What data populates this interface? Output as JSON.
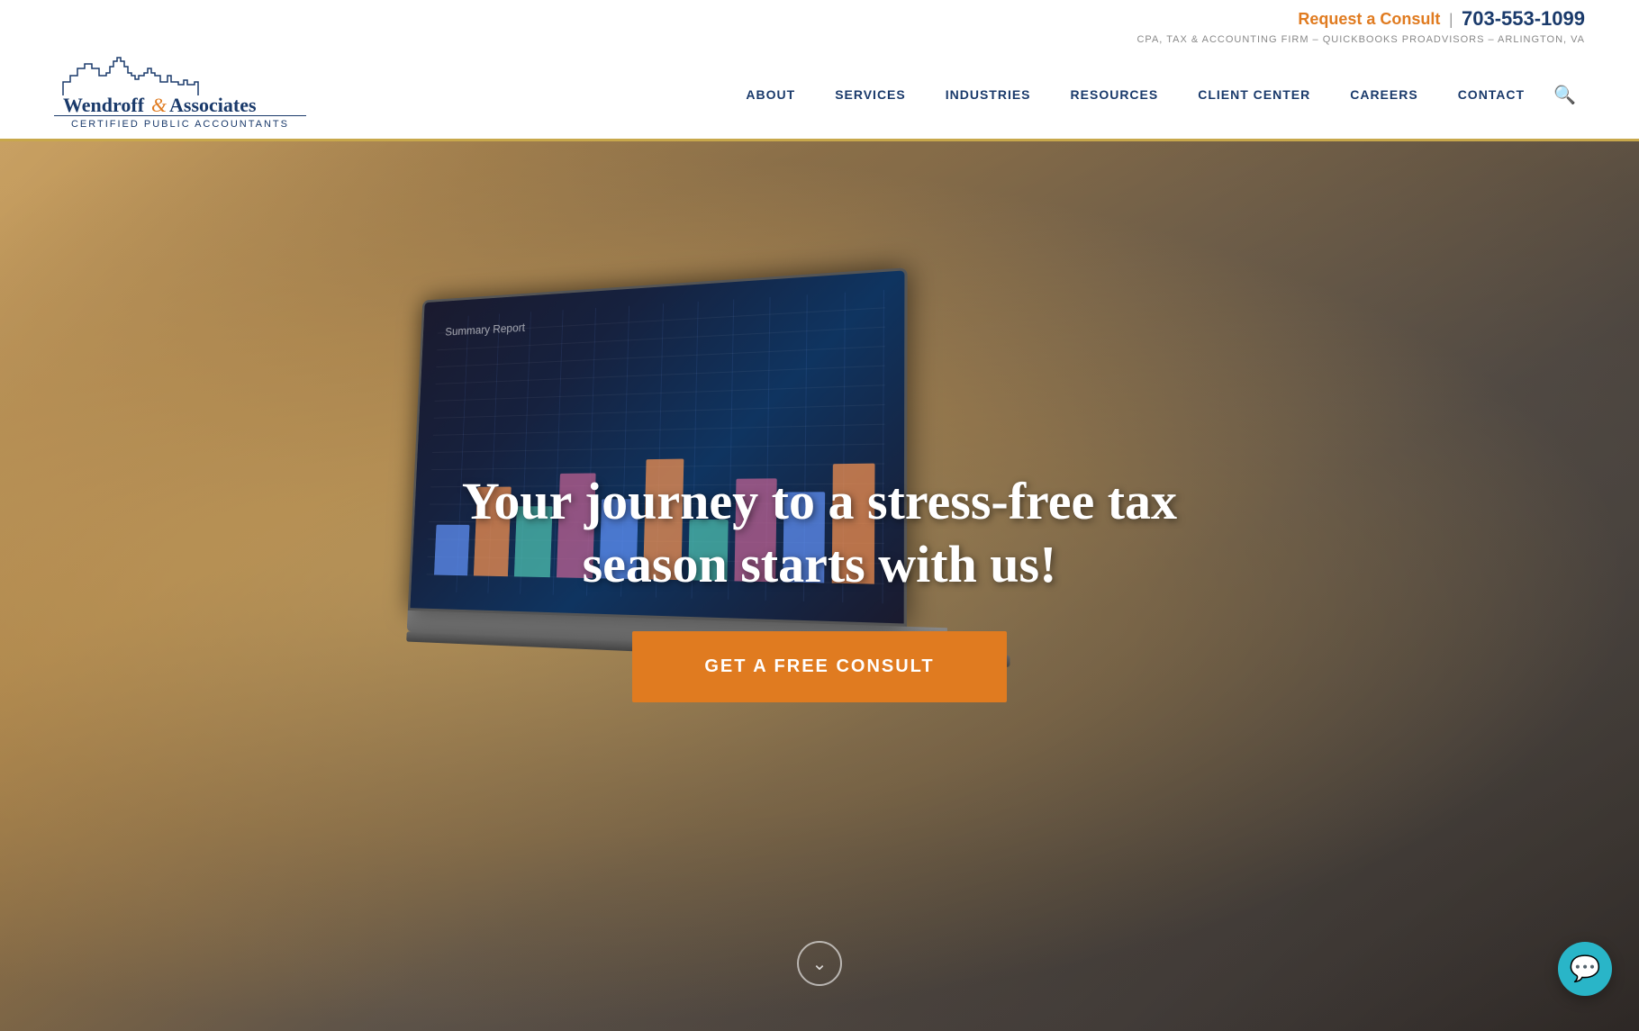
{
  "header": {
    "consult_label": "Request a Consult",
    "divider": "|",
    "phone": "703-553-1099",
    "tagline": "CPA, TAX & ACCOUNTING FIRM – QUICKBOOKS PROADVISORS – ARLINGTON, VA",
    "logo_name": "Wendroff & Associates",
    "logo_subtitle": "CERTIFIED PUBLIC ACCOUNTANTS",
    "nav_items": [
      {
        "label": "ABOUT",
        "id": "about"
      },
      {
        "label": "SERVICES",
        "id": "services"
      },
      {
        "label": "INDUSTRIES",
        "id": "industries"
      },
      {
        "label": "RESOURCES",
        "id": "resources"
      },
      {
        "label": "CLIENT CENTER",
        "id": "client-center"
      },
      {
        "label": "CAREERS",
        "id": "careers"
      },
      {
        "label": "CONTACT",
        "id": "contact"
      }
    ],
    "search_icon": "🔍"
  },
  "hero": {
    "title": "Your journey to a stress-free tax season starts with us!",
    "cta_label": "GET A FREE CONSULT",
    "scroll_down_icon": "∨",
    "chart_bars": [
      40,
      70,
      55,
      80,
      60,
      90,
      45,
      75,
      65,
      85
    ],
    "screen_label": "Summary Report"
  },
  "chat": {
    "icon": "💬"
  }
}
